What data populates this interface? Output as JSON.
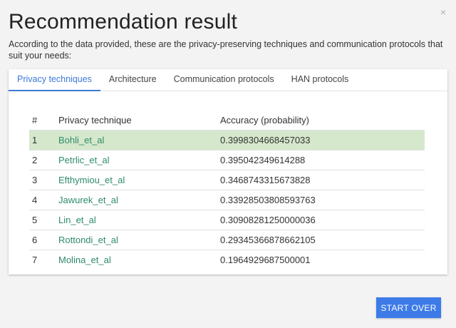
{
  "dialog": {
    "title": "Recommendation result",
    "subtitle": "According to the data provided, these are the privacy-preserving techniques and communication protocols that suit your needs:",
    "close_glyph": "×"
  },
  "tabs": [
    {
      "label": "Privacy techniques",
      "active": true
    },
    {
      "label": "Architecture",
      "active": false
    },
    {
      "label": "Communication protocols",
      "active": false
    },
    {
      "label": "HAN protocols",
      "active": false
    }
  ],
  "table": {
    "headers": [
      "#",
      "Privacy technique",
      "Accuracy (probability)"
    ],
    "rows": [
      {
        "num": "1",
        "technique": "Bohli_et_al",
        "accuracy": "0.3998304668457033",
        "highlighted": true
      },
      {
        "num": "2",
        "technique": "Petrlic_et_al",
        "accuracy": "0.395042349614288",
        "highlighted": false
      },
      {
        "num": "3",
        "technique": "Efthymiou_et_al",
        "accuracy": "0.3468743315673828",
        "highlighted": false
      },
      {
        "num": "4",
        "technique": "Jawurek_et_al",
        "accuracy": "0.33928503808593763",
        "highlighted": false
      },
      {
        "num": "5",
        "technique": "Lin_et_al",
        "accuracy": "0.30908281250000036",
        "highlighted": false
      },
      {
        "num": "6",
        "technique": "Rottondi_et_al",
        "accuracy": "0.29345366878662105",
        "highlighted": false
      },
      {
        "num": "7",
        "technique": "Molina_et_al",
        "accuracy": "0.1964929687500001",
        "highlighted": false
      }
    ]
  },
  "actions": {
    "start_over_label": "START OVER"
  },
  "colors": {
    "accent": "#3b78d8",
    "link": "#2e8b6b",
    "highlight_row": "#d5e8cc",
    "button": "#3d7be8"
  }
}
